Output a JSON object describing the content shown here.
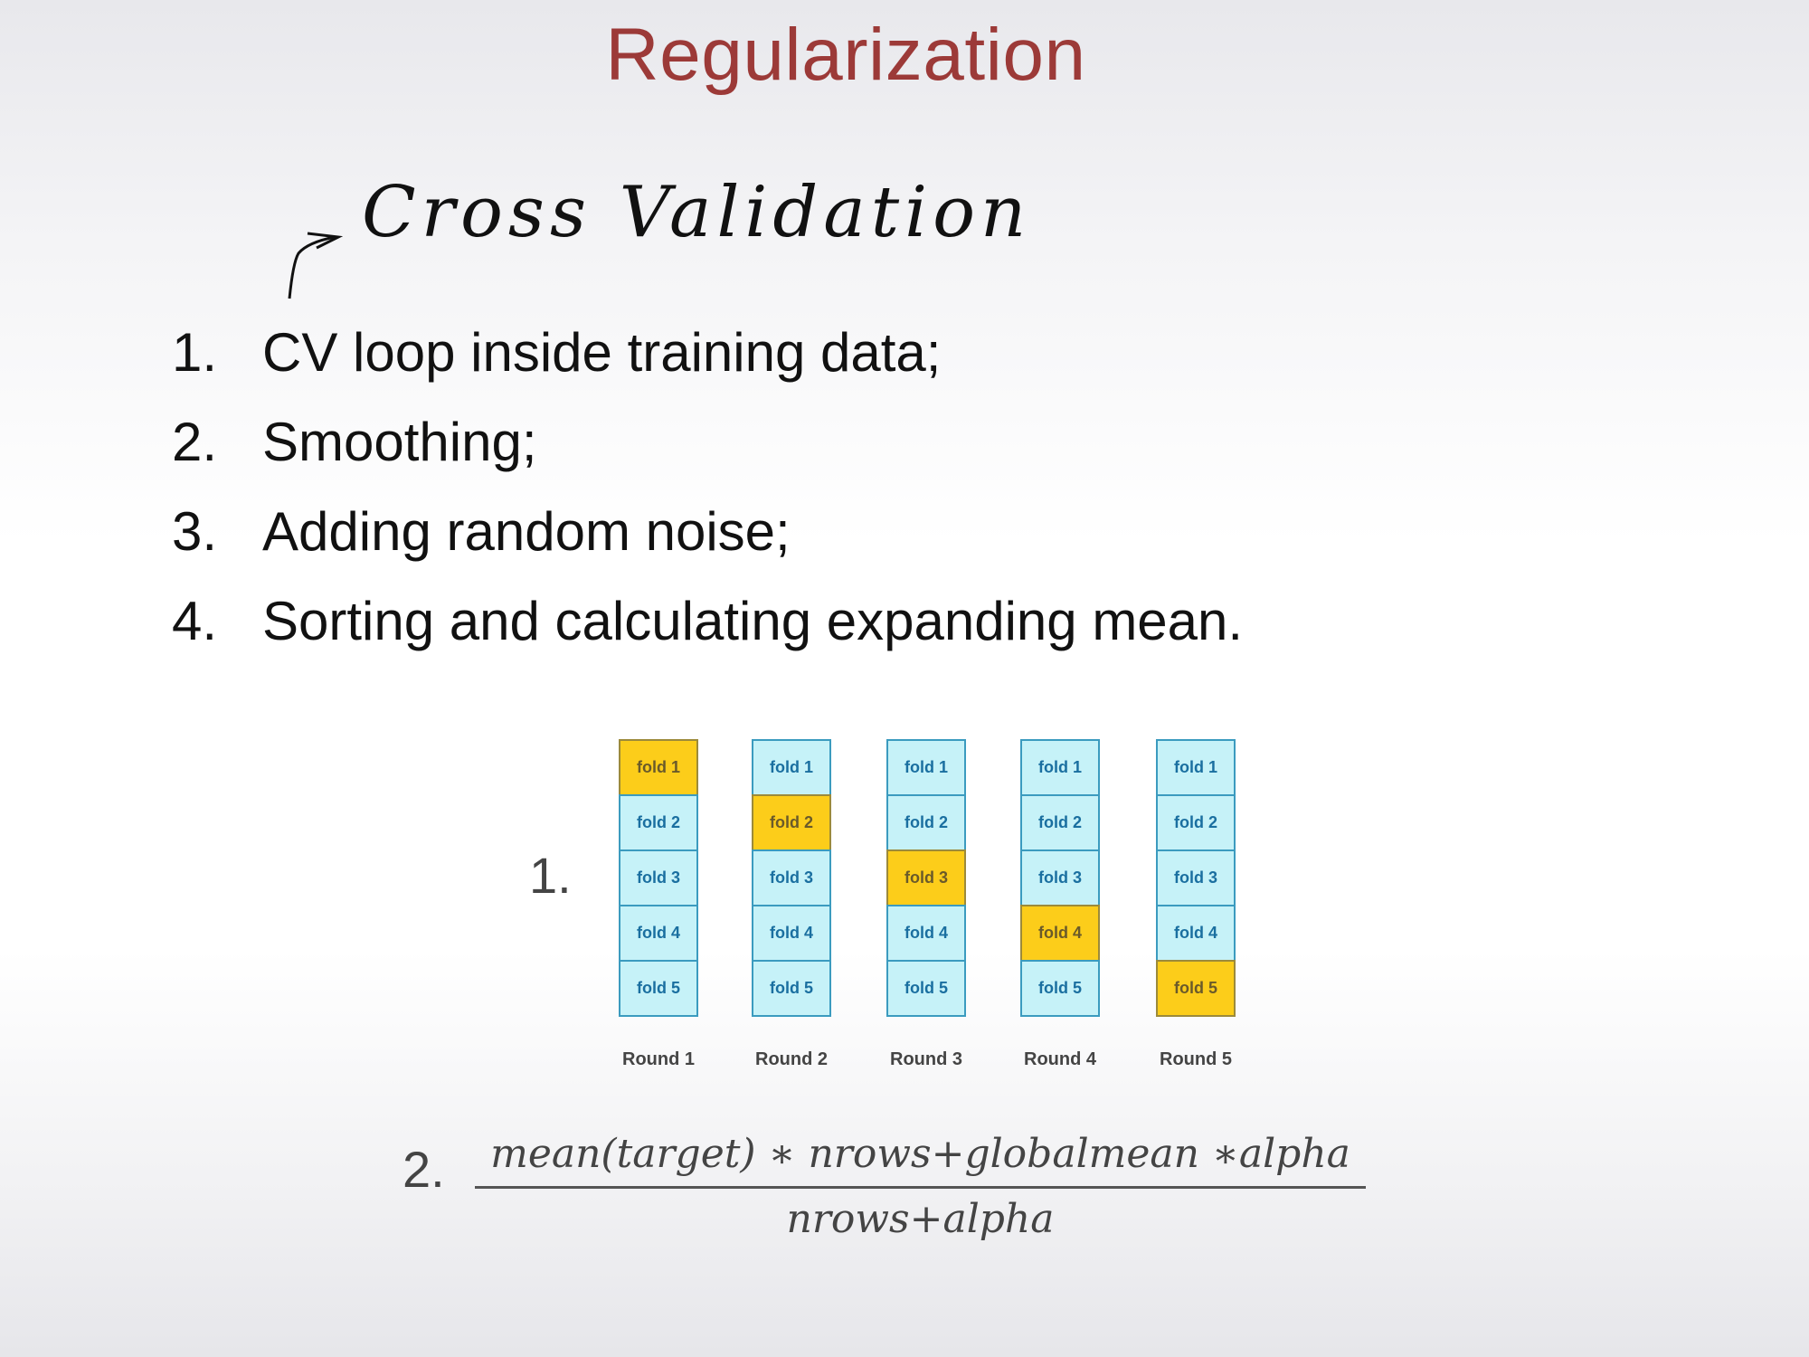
{
  "slide": {
    "title": "Regularization",
    "annotation": "Cross Validation",
    "list": [
      {
        "num": "1.",
        "text": "CV loop inside training data;"
      },
      {
        "num": "2.",
        "text": "Smoothing;"
      },
      {
        "num": "3.",
        "text": "Adding random noise;"
      },
      {
        "num": "4.",
        "text": "Sorting and calculating expanding mean."
      }
    ],
    "diagram_number": "1.",
    "rounds": [
      {
        "label": "Round 1",
        "folds": [
          "fold 1",
          "fold 2",
          "fold 3",
          "fold 4",
          "fold 5"
        ],
        "test_fold_index": 0
      },
      {
        "label": "Round 2",
        "folds": [
          "fold 1",
          "fold 2",
          "fold 3",
          "fold 4",
          "fold 5"
        ],
        "test_fold_index": 1
      },
      {
        "label": "Round 3",
        "folds": [
          "fold 1",
          "fold 2",
          "fold 3",
          "fold 4",
          "fold 5"
        ],
        "test_fold_index": 2
      },
      {
        "label": "Round 4",
        "folds": [
          "fold 1",
          "fold 2",
          "fold 3",
          "fold 4",
          "fold 5"
        ],
        "test_fold_index": 3
      },
      {
        "label": "Round 5",
        "folds": [
          "fold 1",
          "fold 2",
          "fold 3",
          "fold 4",
          "fold 5"
        ],
        "test_fold_index": 4
      }
    ],
    "formula_number": "2.",
    "formula": {
      "numerator": "mean(target) ∗ nrows+globalmean ∗alpha",
      "denominator": "nrows+alpha"
    },
    "colors": {
      "title": "#9c3a38",
      "test_fold": "#fccd1a",
      "train_fold": "#c6f2f8"
    }
  }
}
